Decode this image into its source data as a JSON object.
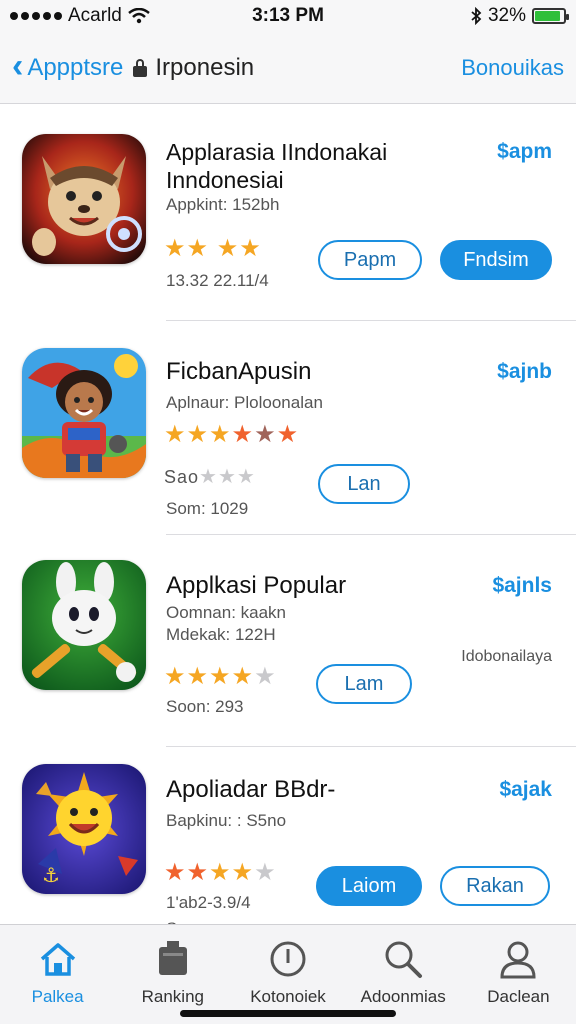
{
  "status_bar": {
    "carrier": "Acarld",
    "time": "3:13 PM",
    "battery_percent": "32%",
    "battery_level": 0.9
  },
  "nav": {
    "back_label": "Appptsre",
    "title": "Irponesin",
    "right_label": "Bonouikas"
  },
  "apps": [
    {
      "name": "Applarasia IIndonakai Inndonesiai",
      "price": "$apm",
      "meta1": "Appkint: 152bh",
      "meta2": "",
      "rating_text": "",
      "meta3": "13.32 22.11/4",
      "button1": "Papm",
      "button2": "Fndsim",
      "side_note": ""
    },
    {
      "name": "FicbanApusin",
      "price": "$ajnb",
      "meta1": "Aplnaur: Ploloonalan",
      "meta2": "",
      "rating_text": "Sao",
      "meta3": "Som: 1029",
      "button1": "Lan",
      "button2": "",
      "side_note": ""
    },
    {
      "name": "Applkasi Popular",
      "price": "$ajnls",
      "meta1": "Oomnan: kaakn",
      "meta2": "Mdekak: 122H",
      "rating_text": "",
      "meta3": "Soon: 293",
      "button1": "Lam",
      "button2": "",
      "side_note": "Idobonailaya"
    },
    {
      "name": "Apoliadar BBdr-",
      "price": "$ajak",
      "meta1": "Bapkinu: : S5no",
      "meta2": "",
      "rating_text": "",
      "meta3": "1'ab2-3.9/4",
      "meta4": "Somon",
      "button1": "Laiom",
      "button2": "Rakan",
      "side_note": ""
    }
  ],
  "tabs": [
    {
      "label": "Palkea",
      "icon": "home-icon"
    },
    {
      "label": "Ranking",
      "icon": "ranking-icon"
    },
    {
      "label": "Kotonoiek",
      "icon": "info-icon"
    },
    {
      "label": "Adoonmias",
      "icon": "search-icon"
    },
    {
      "label": "Daclean",
      "icon": "person-icon"
    }
  ],
  "colors": {
    "accent": "#1a8fe0",
    "star": "#f5a623"
  }
}
